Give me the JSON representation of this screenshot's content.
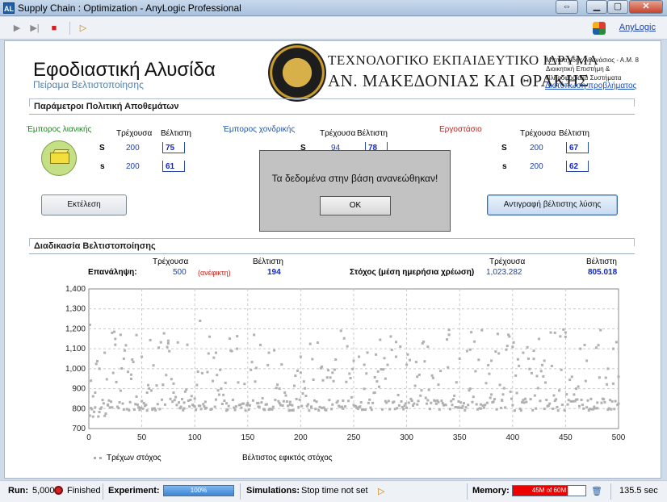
{
  "window": {
    "title": "Supply Chain : Optimization - AnyLogic Professional",
    "icon_text": "AL"
  },
  "toolbar": {
    "anylogic_link": "AnyLogic"
  },
  "header": {
    "title": "Εφοδιαστική Αλυσίδα",
    "subtitle": "Πείραμα Βελτιστοποίησης",
    "institution_line1": "ΤΕΧΝΟΛΟΓΙΚΟ ΕΚΠΑΙΔΕΥΤΙΚΟ ΙΔΡΥΜΑ",
    "institution_line2": "ΑΝ. ΜΑΚΕΔΟΝΙΑΣ ΚΑΙ ΘΡΑΚΗΣ",
    "author_line1": "Μπιτσαχίδης Αθανάσιος - Α.Μ. 8",
    "author_line2": "Διοικητική Επιστήμη &",
    "author_line3": "Πληροφοριακά Συστήματα",
    "problem_link": "Διατύπωση προβλήματος"
  },
  "params": {
    "section_title": "Παράμετροι Πολιτική Αποθεμάτων",
    "current_label": "Τρέχουσα",
    "best_label": "Βέλτιστη",
    "S_label": "S",
    "s_label": "s",
    "retail": {
      "name": "Έμπορος λιανικής",
      "S_current": "200",
      "S_best": "75",
      "s_current": "200",
      "s_best": "61"
    },
    "wholesale": {
      "name": "Έμπορος χονδρικής",
      "S_current": "94",
      "S_best": "78"
    },
    "factory": {
      "name": "Εργοστάσιο",
      "S_current": "200",
      "S_best": "67",
      "s_current": "200",
      "s_best": "62"
    },
    "run_button": "Εκτέλεση",
    "copy_button": "Αντιγραφή βέλτιστης λύσης"
  },
  "dialog": {
    "message": "Τα δεδομένα στην βάση ανανεώθηκαν!",
    "ok_label": "OK"
  },
  "optimization": {
    "section_title": "Διαδικασία Βελτιστοποίησης",
    "current_label": "Τρέχουσα",
    "best_label": "Βέλτιστη",
    "iteration_label": "Επανάληψη:",
    "iteration_current": "500",
    "infeasible_label": "(ανέφικτη)",
    "iteration_best": "194",
    "objective_label": "Στόχος (μέση ημερήσια χρέωση)",
    "objective_current": "1,023.282",
    "objective_best": "805.018"
  },
  "chart_data": {
    "type": "scatter",
    "xlim": [
      0,
      500
    ],
    "ylim": [
      700,
      1400
    ],
    "x_ticks": [
      "0",
      "50",
      "100",
      "150",
      "200",
      "250",
      "300",
      "350",
      "400",
      "450",
      "500"
    ],
    "y_ticks": [
      "700",
      "800",
      "900",
      "1,000",
      "1,100",
      "1,200",
      "1,300",
      "1,400"
    ],
    "grid": true,
    "legend_position": "bottom",
    "series": [
      {
        "name": "Τρέχων στόχος",
        "color": "#b0b0b0",
        "points": "approximately 500 points (one per iteration 1–500), dense band 780–860 with scattered values up to ~1,240"
      },
      {
        "name": "Βέλτιστος εφικτός στόχος",
        "color": "#3050c0",
        "points": "best feasible objective ~805.018 (not drawn as visible line)"
      }
    ],
    "sample_points": [
      [
        1,
        1220
      ],
      [
        2,
        940
      ],
      [
        4,
        760
      ],
      [
        6,
        880
      ],
      [
        10,
        1000
      ],
      [
        15,
        1080
      ],
      [
        18,
        820
      ],
      [
        22,
        1180
      ],
      [
        25,
        1120
      ],
      [
        30,
        1170
      ],
      [
        33,
        1050
      ],
      [
        40,
        970
      ],
      [
        45,
        860
      ],
      [
        50,
        1060
      ],
      [
        55,
        880
      ],
      [
        60,
        800
      ],
      [
        70,
        920
      ],
      [
        75,
        1140
      ],
      [
        80,
        880
      ],
      [
        90,
        830
      ],
      [
        100,
        850
      ],
      [
        105,
        1240
      ],
      [
        110,
        800
      ],
      [
        120,
        1080
      ],
      [
        130,
        790
      ],
      [
        140,
        1100
      ],
      [
        150,
        820
      ],
      [
        160,
        810
      ],
      [
        170,
        1080
      ],
      [
        180,
        900
      ],
      [
        190,
        820
      ],
      [
        200,
        1060
      ],
      [
        210,
        810
      ],
      [
        220,
        1010
      ],
      [
        230,
        980
      ],
      [
        240,
        800
      ],
      [
        250,
        1040
      ],
      [
        255,
        1060
      ],
      [
        260,
        1020
      ],
      [
        270,
        880
      ],
      [
        280,
        950
      ],
      [
        290,
        1060
      ],
      [
        300,
        1020
      ],
      [
        310,
        960
      ],
      [
        320,
        1110
      ],
      [
        330,
        920
      ],
      [
        340,
        1170
      ],
      [
        350,
        1050
      ],
      [
        360,
        900
      ],
      [
        370,
        800
      ],
      [
        380,
        1040
      ],
      [
        390,
        840
      ],
      [
        400,
        1110
      ],
      [
        410,
        1080
      ],
      [
        420,
        1090
      ],
      [
        430,
        1040
      ],
      [
        440,
        1180
      ],
      [
        450,
        1160
      ],
      [
        460,
        900
      ],
      [
        470,
        1040
      ],
      [
        480,
        830
      ],
      [
        490,
        1000
      ],
      [
        495,
        1100
      ],
      [
        500,
        960
      ]
    ]
  },
  "legend": {
    "current": "Τρέχων στόχος",
    "best": "Βέλτιστος εφικτός στόχος"
  },
  "status": {
    "run_label": "Run:",
    "run_value": "5,000",
    "run_state": "Finished",
    "experiment_label": "Experiment:",
    "experiment_progress": "100%",
    "experiment_fraction": 1.0,
    "simulations_label": "Simulations:",
    "simulations_value": "Stop time not set",
    "memory_label": "Memory:",
    "memory_text": "45M of 60M",
    "memory_fraction": 0.75,
    "time": "135.5 sec"
  }
}
